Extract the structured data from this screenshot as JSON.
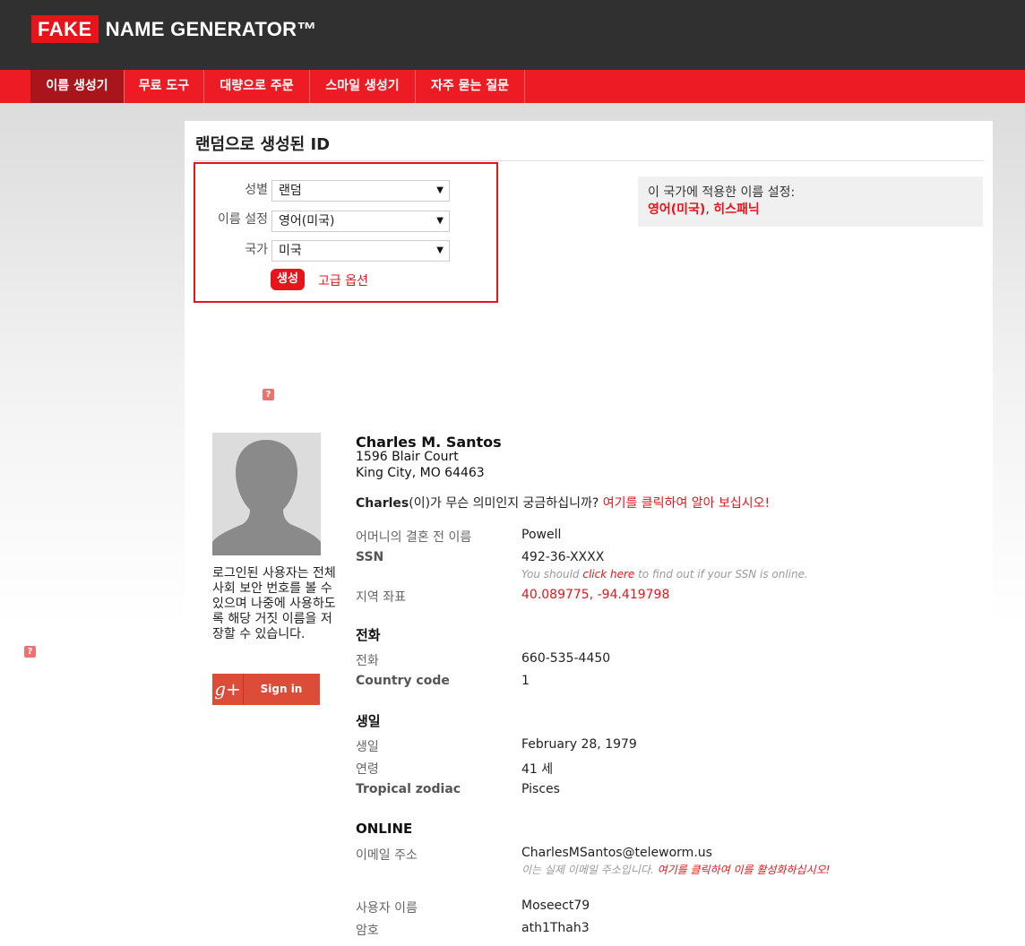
{
  "header": {
    "logo_fake": "FAKE",
    "logo_rest": "NAME GENERATOR™"
  },
  "nav": {
    "items": [
      {
        "label": "이름 생성기",
        "active": true
      },
      {
        "label": "무료 도구"
      },
      {
        "label": "대량으로 주문"
      },
      {
        "label": "스마일 생성기"
      },
      {
        "label": "자주 묻는 질문"
      }
    ]
  },
  "page": {
    "title": "랜덤으로 생성된 ID"
  },
  "generator": {
    "gender_label": "성별",
    "gender_value": "랜덤",
    "nameset_label": "이름 설정",
    "nameset_value": "영어(미국)",
    "country_label": "국가",
    "country_value": "미국",
    "generate_button": "생성",
    "advanced_link": "고급 옵션"
  },
  "info_box": {
    "line1": "이 국가에 적용한 이름 설정:",
    "nameset1": "영어(미국)",
    "separator": ", ",
    "nameset2": "히스패닉"
  },
  "help_icon": "?",
  "sidebar": {
    "login_text": "로그인된 사용자는 전체 사회 보안 번호를 볼 수 있으며 나중에 사용하도록 해당 거짓 이름을 저장할 수 있습니다.",
    "google_label": "Sign in"
  },
  "identity": {
    "name": "Charles M. Santos",
    "address_line1": "1596 Blair Court",
    "address_line2": "King City, MO 64463",
    "meaning_name": "Charles",
    "meaning_text": "(이)가 무슨 의미인지 궁금하십니까? ",
    "meaning_link": "여기를 클릭하여 알아 보십시오!",
    "maiden_label": "어머니의 결혼 전 이름",
    "maiden_value": "Powell",
    "ssn_label": "SSN",
    "ssn_value": "492-36-XXXX",
    "ssn_note_pre": "You should ",
    "ssn_note_link": "click here",
    "ssn_note_post": " to find out if your SSN is online.",
    "geo_label": "지역 좌표",
    "geo_value": "40.089775, -94.419798",
    "phone_section": "전화",
    "phone_label": "전화",
    "phone_value": "660-535-4450",
    "country_code_label": "Country code",
    "country_code_value": "1",
    "birthday_section": "생일",
    "birthday_label": "생일",
    "birthday_value": "February 28, 1979",
    "age_label": "연령",
    "age_value": "41 세",
    "zodiac_label": "Tropical zodiac",
    "zodiac_value": "Pisces",
    "online_section": "ONLINE",
    "email_label": "이메일 주소",
    "email_value": "CharlesMSantos@teleworm.us",
    "email_note_pre": "이는 실제 이메일 주소입니다. ",
    "email_note_link": "여기를 클릭하여 이를 활성화하십시오!",
    "username_label": "사용자 이름",
    "username_value": "Moseect79",
    "password_label": "암호",
    "password_value": "ath1Thah3"
  },
  "colors": {
    "brand_red": "#e8141b",
    "header_dark": "#303030",
    "nav_active": "#a8151a",
    "google_red": "#dd4b39"
  }
}
